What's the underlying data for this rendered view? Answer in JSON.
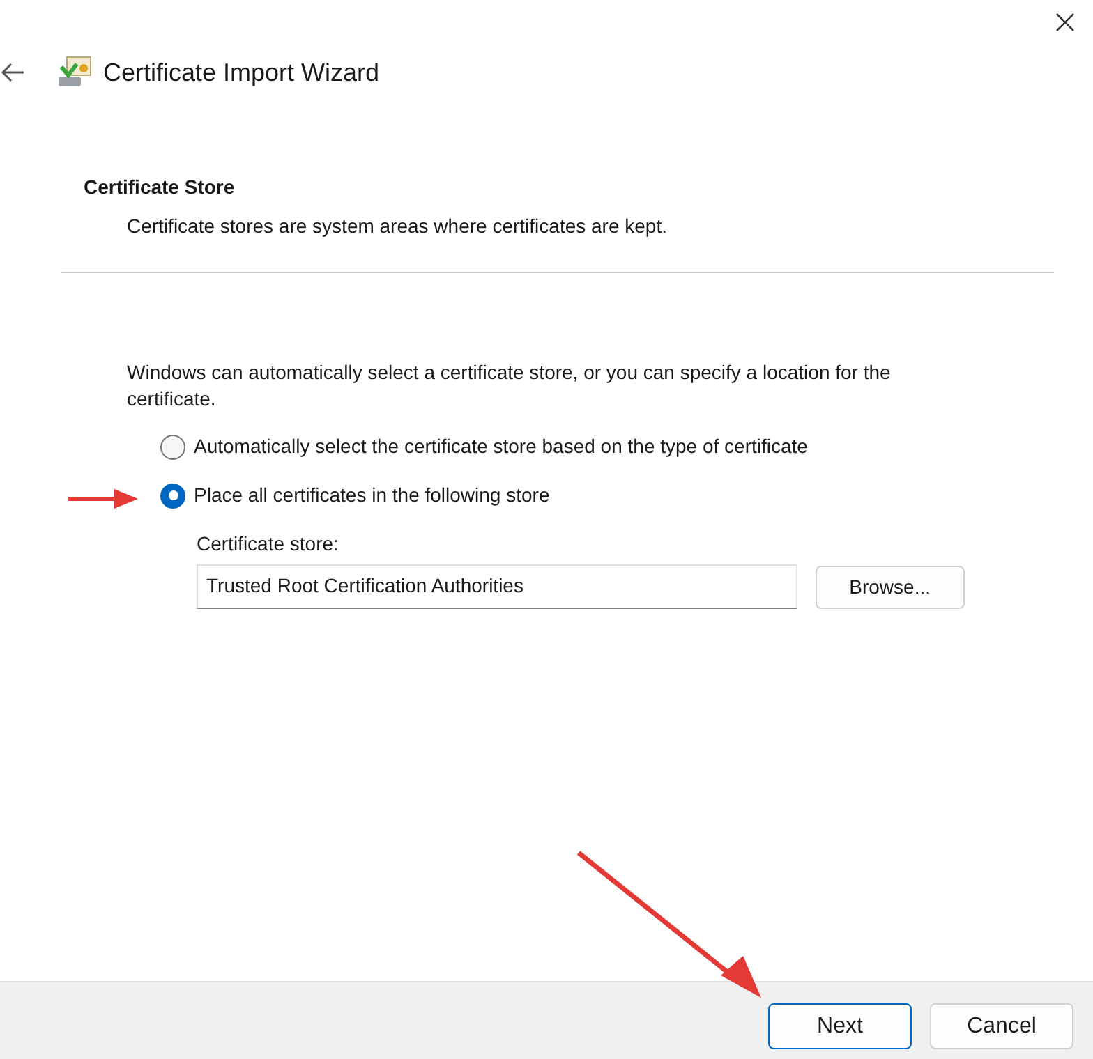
{
  "window": {
    "title": "Certificate Import Wizard"
  },
  "section": {
    "title": "Certificate Store",
    "subtitle": "Certificate stores are system areas where certificates are kept."
  },
  "intro": "Windows can automatically select a certificate store, or you can specify a location for the certificate.",
  "options": [
    {
      "label": "Automatically select the certificate store based on the type of certificate",
      "selected": false
    },
    {
      "label": "Place all certificates in the following store",
      "selected": true
    }
  ],
  "store": {
    "label": "Certificate store:",
    "value": "Trusted Root Certification Authorities",
    "browse": "Browse..."
  },
  "buttons": [
    {
      "label": "Next",
      "default": true
    },
    {
      "label": "Cancel",
      "default": false
    }
  ]
}
